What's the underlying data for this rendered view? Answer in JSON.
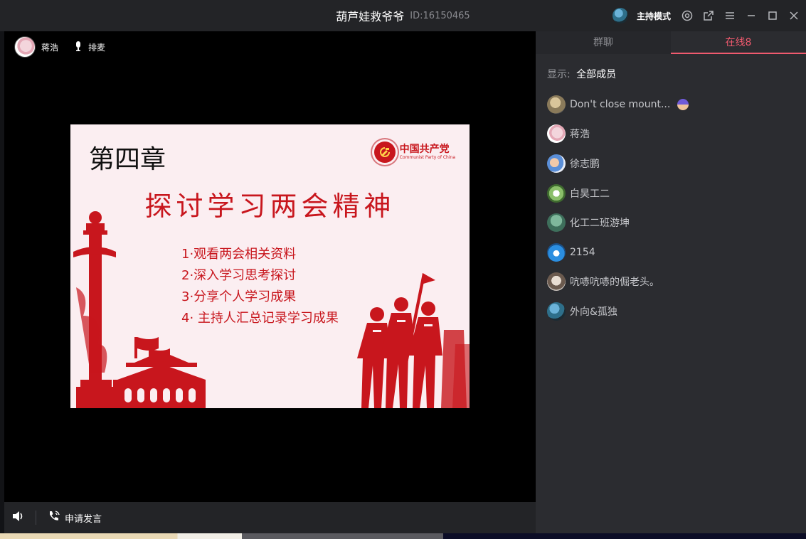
{
  "titlebar": {
    "room_name": "葫芦娃救爷爷",
    "room_id": "ID:16150465",
    "host_mode": "主持模式",
    "icons": [
      "target-icon",
      "popout-icon",
      "menu-icon",
      "minimize-icon",
      "maximize-icon",
      "close-icon"
    ]
  },
  "stage": {
    "speaker_name": "蒋浩",
    "queue_label": "排麦"
  },
  "slide": {
    "chapter": "第四章",
    "logo_cn": "中国共产党",
    "logo_en": "Communist Party of China",
    "heading": "探讨学习两会精神",
    "items": [
      "1·观看两会相关资料",
      "2·深入学习思考探讨",
      "3·分享个人学习成果",
      "4· 主持人汇总记录学习成果"
    ],
    "accent_color": "#c8161d"
  },
  "bottombar": {
    "request_label": "申请发言"
  },
  "panel": {
    "tabs": [
      "群聊",
      "在线8"
    ],
    "active_tab": "在线8",
    "filter_label": "显示:",
    "filter_value": "全部成员",
    "members": [
      {
        "name": "Don't close mount..."
      },
      {
        "name": "蒋浩"
      },
      {
        "name": "徐志鹏"
      },
      {
        "name": "白昊工二"
      },
      {
        "name": "化工二班游坤"
      },
      {
        "name": "2154"
      },
      {
        "name": "吭哧吭哧的倔老头。"
      },
      {
        "name": "外向&孤独"
      }
    ]
  }
}
